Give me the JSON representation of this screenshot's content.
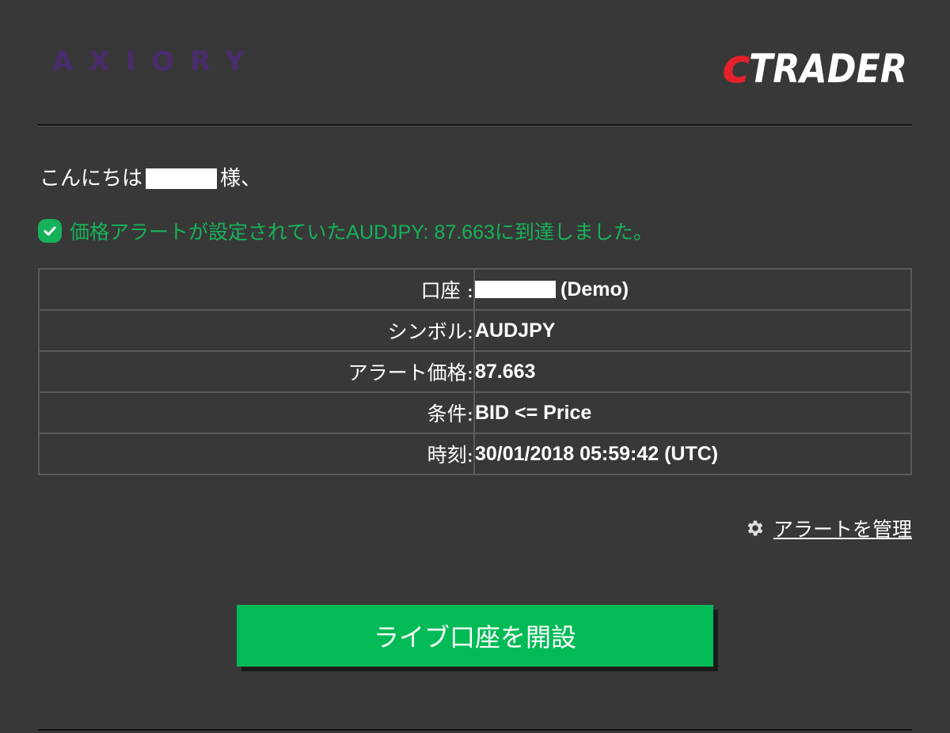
{
  "header": {
    "left_brand": "AXIORY",
    "right_brand": "cTRADER",
    "colors": {
      "axiory": "#4a2b6e",
      "ctrader_red": "#e3212c",
      "ctrader_white": "#ffffff"
    }
  },
  "greeting": {
    "prefix": "こんにちは",
    "suffix": "様、"
  },
  "alert": {
    "icon": "check-circle-icon",
    "part1": "価格アラートが設定されていた",
    "part2": "AUDJPY: 87.663",
    "part3": "に到達しました。",
    "color": "#16b25a"
  },
  "details": {
    "rows": [
      {
        "label": "口座 :",
        "value": "(Demo)"
      },
      {
        "label": "シンボル:",
        "value": "AUDJPY"
      },
      {
        "label": "アラート価格:",
        "value": "87.663"
      },
      {
        "label": "条件:",
        "value": "BID <= Price"
      },
      {
        "label": "時刻:",
        "value": "30/01/2018 05:59:42 (UTC)"
      }
    ]
  },
  "manage_alerts": {
    "icon": "gear-icon",
    "label": "アラートを管理"
  },
  "cta": {
    "label": "ライブ口座を開設",
    "color": "#03bb56"
  }
}
